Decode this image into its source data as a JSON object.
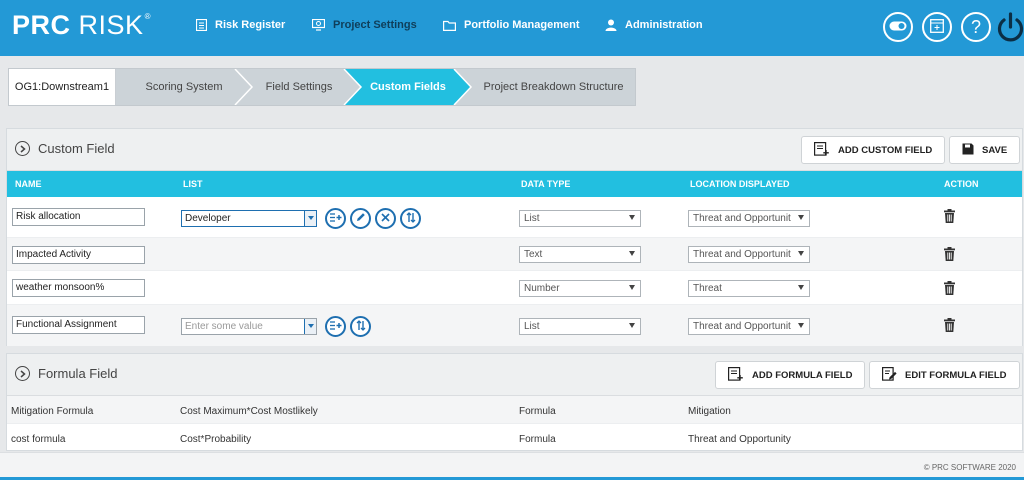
{
  "brand": {
    "name_bold": "PRC",
    "name_rest": "RISK",
    "mark": "®"
  },
  "nav": [
    {
      "label": "Risk Register"
    },
    {
      "label": "Project Settings"
    },
    {
      "label": "Portfolio Management"
    },
    {
      "label": "Administration"
    }
  ],
  "header_icons": [
    "toggle-icon",
    "calculator-icon",
    "help-icon",
    "power-icon"
  ],
  "breadcrumb": [
    {
      "label": "OG1:Downstream1"
    },
    {
      "label": "Scoring System"
    },
    {
      "label": "Field Settings"
    },
    {
      "label": "Custom Fields",
      "active": true
    },
    {
      "label": "Project Breakdown Structure"
    }
  ],
  "custom_field": {
    "title": "Custom Field",
    "add_button": "ADD CUSTOM FIELD",
    "save_button": "SAVE",
    "columns": [
      "NAME",
      "LIST",
      "DATA TYPE",
      "LOCATION DISPLAYED",
      "ACTION"
    ],
    "rows": [
      {
        "name": "Risk allocation",
        "list_value": "Developer",
        "data_type": "List",
        "location": "Threat and Opportunit"
      },
      {
        "name": "Impacted Activity",
        "data_type": "Text",
        "location": "Threat and Opportunit"
      },
      {
        "name": "weather monsoon%",
        "data_type": "Number",
        "location": "Threat"
      },
      {
        "name": "Functional Assignment",
        "list_placeholder": "Enter some value",
        "data_type": "List",
        "location": "Threat and Opportunit"
      }
    ]
  },
  "formula_field": {
    "title": "Formula Field",
    "add_button": "ADD FORMULA FIELD",
    "edit_button": "EDIT FORMULA FIELD",
    "rows": [
      {
        "name": "Mitigation Formula",
        "expression": "Cost Maximum*Cost Mostlikely",
        "data_type": "Formula",
        "location": "Mitigation"
      },
      {
        "name": "cost formula",
        "expression": "Cost*Probability",
        "data_type": "Formula",
        "location": "Threat and Opportunity"
      }
    ]
  },
  "footer": {
    "copyright": "© PRC SOFTWARE 2020"
  },
  "colors": {
    "header": "#2399d6",
    "table_header": "#22bfe0",
    "breadcrumb_active": "#22bfe0",
    "icon_blue": "#1e6fb0"
  }
}
